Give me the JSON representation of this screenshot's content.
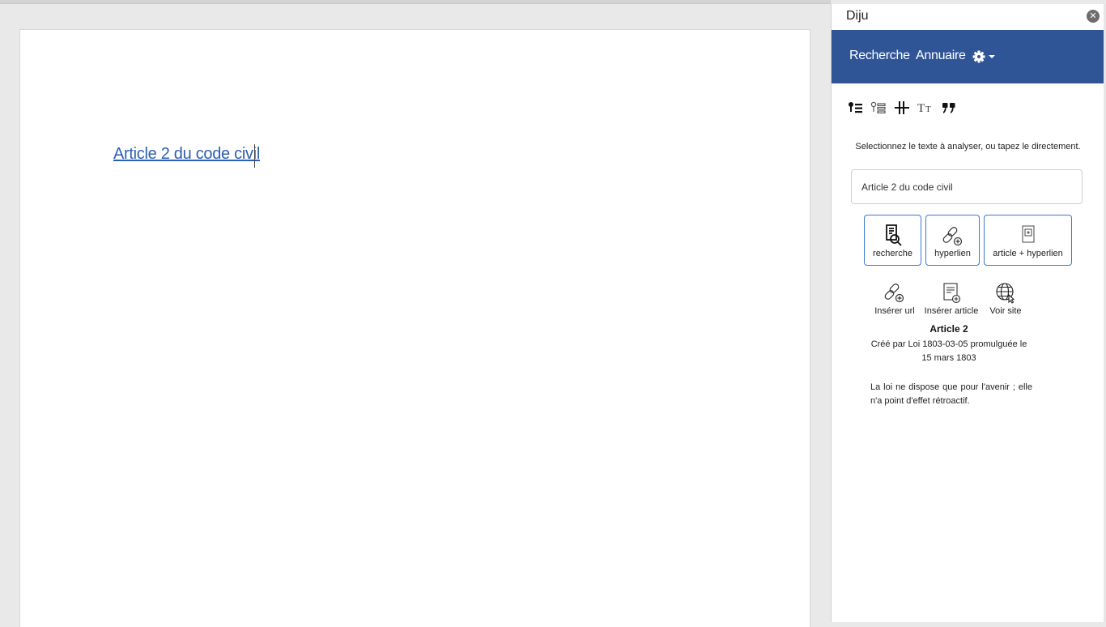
{
  "document": {
    "link_text": "Article 2 du code civil"
  },
  "pane": {
    "title": "Diju",
    "close_icon": "close-circle-icon",
    "nav": {
      "recherche": "Recherche",
      "annuaire": "Annuaire",
      "settings_icon": "gear-icon"
    },
    "toolbar_icons": [
      "key-list-icon",
      "key-list-outline-icon",
      "split-icon",
      "text-size-icon",
      "quote-icon"
    ],
    "hint": "Selectionnez le texte à analyser, ou tapez le directement.",
    "search_value": "Article 2 du code civil",
    "primary_buttons": {
      "recherche": "recherche",
      "hyperlien": "hyperlien",
      "article_hyperlien": "article + hyperlien"
    },
    "secondary_buttons": {
      "inserer_url": "Insérer url",
      "inserer_article": "Insérer article",
      "voir_site": "Voir site"
    },
    "article": {
      "title": "Article 2",
      "meta": "Créé par Loi 1803-03-05 promulguée le 15 mars 1803",
      "text": "La loi ne dispose que pour l'avenir ; elle n'a point d'effet rétroactif."
    },
    "colors": {
      "navbar": "#2f5596",
      "button_border": "#3b77d6",
      "link": "#2c5fb3"
    }
  }
}
